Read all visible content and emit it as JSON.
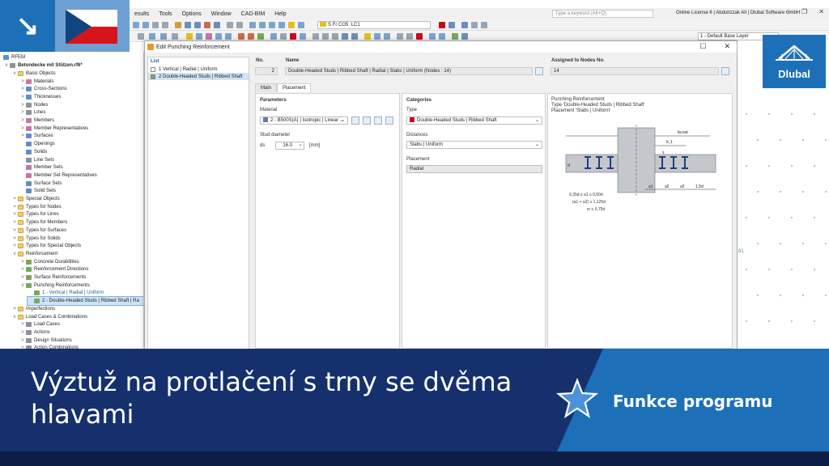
{
  "menu": {
    "items": [
      "esults",
      "Tools",
      "Options",
      "Window",
      "CAD-BIM",
      "Help"
    ],
    "search_placeholder": "Type a keyword (Alt+Q)",
    "license": "Online License 6 | Abdulrzzak Ali | Dlubal Software GmbH"
  },
  "toolbar": {
    "load_case_tag": "S Fr",
    "load_case_code": "CO5",
    "load_case_name": "LC1",
    "layer": "1 - Default Base Layer"
  },
  "navigator": {
    "root": "RFEM",
    "model": "Betondecke mit Stützen.rf6*",
    "rows": [
      {
        "label": "Basic Objects",
        "level": 1,
        "expand": "v",
        "icon": "folder"
      },
      {
        "label": "Materials",
        "level": 2,
        "expand": ">",
        "icon": "pinkicon"
      },
      {
        "label": "Cross-Sections",
        "level": 2,
        "expand": ">",
        "icon": "blueicon"
      },
      {
        "label": "Thicknesses",
        "level": 2,
        "expand": ">",
        "icon": "blueicon"
      },
      {
        "label": "Nodes",
        "level": 2,
        "expand": ">",
        "icon": "greyicon"
      },
      {
        "label": "Lines",
        "level": 2,
        "expand": ">",
        "icon": "greyicon"
      },
      {
        "label": "Members",
        "level": 2,
        "expand": ">",
        "icon": "pinkicon"
      },
      {
        "label": "Member Representatives",
        "level": 2,
        "expand": ">",
        "icon": "pinkicon"
      },
      {
        "label": "Surfaces",
        "level": 2,
        "expand": ">",
        "icon": "blueicon"
      },
      {
        "label": "Openings",
        "level": 2,
        "expand": "",
        "icon": "blueicon"
      },
      {
        "label": "Solids",
        "level": 2,
        "expand": "",
        "icon": "blueicon"
      },
      {
        "label": "Line Sets",
        "level": 2,
        "expand": "",
        "icon": "greyicon"
      },
      {
        "label": "Member Sets",
        "level": 2,
        "expand": "",
        "icon": "pinkicon"
      },
      {
        "label": "Member Set Representatives",
        "level": 2,
        "expand": "",
        "icon": "pinkicon"
      },
      {
        "label": "Surface Sets",
        "level": 2,
        "expand": "",
        "icon": "blueicon"
      },
      {
        "label": "Solid Sets",
        "level": 2,
        "expand": "",
        "icon": "blueicon"
      },
      {
        "label": "Special Objects",
        "level": 1,
        "expand": ">",
        "icon": "folder"
      },
      {
        "label": "Types for Nodes",
        "level": 1,
        "expand": ">",
        "icon": "folder"
      },
      {
        "label": "Types for Lines",
        "level": 1,
        "expand": ">",
        "icon": "folder"
      },
      {
        "label": "Types for Members",
        "level": 1,
        "expand": ">",
        "icon": "folder"
      },
      {
        "label": "Types for Surfaces",
        "level": 1,
        "expand": ">",
        "icon": "folder"
      },
      {
        "label": "Types for Solids",
        "level": 1,
        "expand": ">",
        "icon": "folder"
      },
      {
        "label": "Types for Special Objects",
        "level": 1,
        "expand": ">",
        "icon": "folder"
      },
      {
        "label": "Reinforcement",
        "level": 1,
        "expand": "v",
        "icon": "folder"
      },
      {
        "label": "Concrete Durabilities",
        "level": 2,
        "expand": ">",
        "icon": "greenicon"
      },
      {
        "label": "Reinforcement Directions",
        "level": 2,
        "expand": ">",
        "icon": "greenicon"
      },
      {
        "label": "Surface Reinforcements",
        "level": 2,
        "expand": ">",
        "icon": "greenicon"
      },
      {
        "label": "Punching Reinforcements",
        "level": 2,
        "expand": "v",
        "icon": "greenicon"
      },
      {
        "label": "1 - Vertical | Radial | Uniform",
        "level": 3,
        "expand": "",
        "icon": "greenicon",
        "link": true
      },
      {
        "label": "2 - Double-Headed Studs | Ribbed Shaft | Ra",
        "level": 3,
        "expand": "",
        "icon": "greenicon",
        "selected": true
      },
      {
        "label": "Imperfections",
        "level": 1,
        "expand": ">",
        "icon": "folder"
      },
      {
        "label": "Load Cases & Combinations",
        "level": 1,
        "expand": "v",
        "icon": "folder"
      },
      {
        "label": "Load Cases",
        "level": 2,
        "expand": ">",
        "icon": "greyicon"
      },
      {
        "label": "Actions",
        "level": 2,
        "expand": ">",
        "icon": "greyicon"
      },
      {
        "label": "Design Situations",
        "level": 2,
        "expand": ">",
        "icon": "greyicon"
      },
      {
        "label": "Action Combinations",
        "level": 2,
        "expand": ">",
        "icon": "greyicon"
      }
    ]
  },
  "dialog": {
    "title": "Edit Punching Reinforcement",
    "list_header": "List",
    "list_items": [
      "1  Vertical | Radial | Uniform",
      "2  Double-Headed Studs | Ribbed Shaft"
    ],
    "no_header": "No.",
    "no_value": "2",
    "name_header": "Name",
    "name_value": "Double-Headed Studs | Ribbed Shaft | Radial | Slabs | Uniform (Nodes : 14)",
    "assigned_header": "Assigned to Nodes No.",
    "assigned_value": "14",
    "tabs": [
      "Main",
      "Placement"
    ],
    "parameters_header": "Parameters",
    "material_label": "Material",
    "material_value": "2 - B500S(A) | Isotropic | Linear ...",
    "stud_label": "Stud diameter",
    "stud_symbol": "ds",
    "stud_value": "16.0",
    "stud_unit": "[mm]",
    "categories_header": "Categories",
    "type_label": "Type",
    "type_value": "Double-Headed Studs | Ribbed Shaft",
    "distances_label": "Distances",
    "distances_value": "Slabs | Uniform",
    "placement_label": "Placement",
    "placement_value": "Radial",
    "diagram": {
      "line1": "Punching Reinforcement",
      "line2": "Type 'Double-Headed Studs | Ribbed Shaft'",
      "line3": "Placement 'Slabs | Uniform'",
      "lw_out": "lw,out",
      "lc1": "lc,1",
      "a1": "a1",
      "a2": "a2",
      "d": "d",
      "s": "s",
      "dim_1": "a1",
      "dim_2": "a2",
      "dim_3": "a2",
      "dim_4": "1.5d",
      "eq1": "0,35d ≥ a1 ≤ 0,50d",
      "eq2": "(a1 + a2) ≤ 1,125d",
      "eq3": "sr ≤ 0,75d"
    }
  },
  "grid_label": "81",
  "logo_text": "Dlubal",
  "banner": {
    "title": "Výztuž na protlačení s trny se dvěma hlavami",
    "badge": "Funkce programu"
  },
  "colors": {
    "banner_bg": "#16306e",
    "badge_bg": "#1d70b8",
    "accent_blue": "#1f5e9c",
    "selection": "#cfe3f7"
  }
}
